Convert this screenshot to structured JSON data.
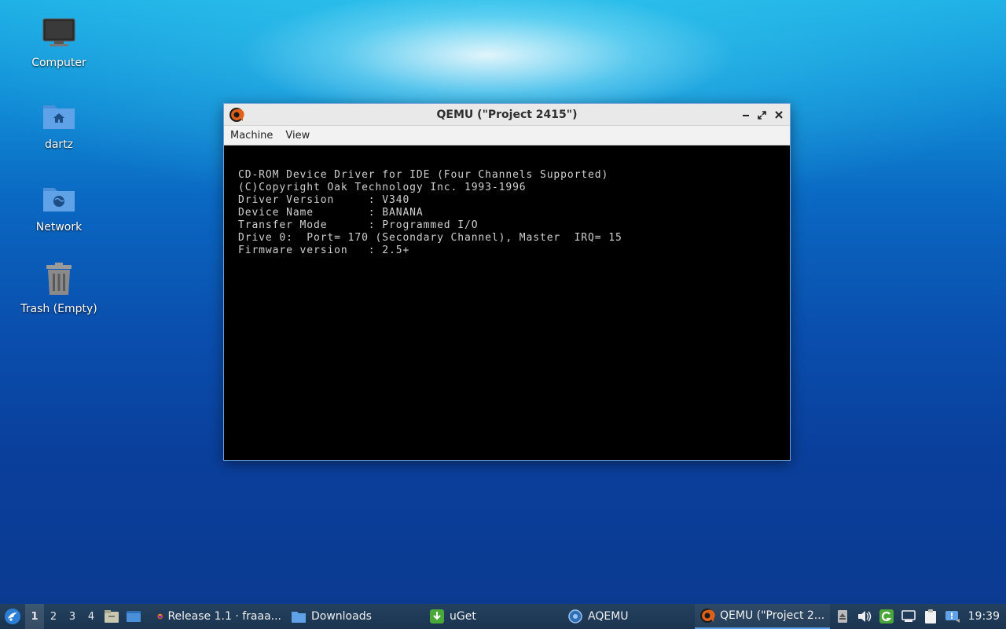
{
  "desktop": {
    "icons": [
      {
        "label": "Computer"
      },
      {
        "label": "dartz"
      },
      {
        "label": "Network"
      },
      {
        "label": "Trash (Empty)"
      }
    ]
  },
  "window": {
    "title": "QEMU (\"Project 2415\")",
    "menu": [
      "Machine",
      "View"
    ],
    "screen_lines": [
      "CD-ROM Device Driver for IDE (Four Channels Supported)",
      "(C)Copyright Oak Technology Inc. 1993-1996",
      "Driver Version     : V340",
      "Device Name        : BANANA",
      "Transfer Mode      : Programmed I/O",
      "Drive 0:  Port= 170 (Secondary Channel), Master  IRQ= 15",
      "Firmware version   : 2.5+"
    ]
  },
  "taskbar": {
    "workspaces": [
      "1",
      "2",
      "3",
      "4"
    ],
    "tasks": [
      {
        "label": "Release 1.1 · fraaa..."
      },
      {
        "label": "Downloads"
      },
      {
        "label": "uGet"
      },
      {
        "label": "AQEMU"
      },
      {
        "label": "QEMU (\"Project 2..."
      }
    ],
    "clock": "19:39"
  },
  "colors": {
    "taskbar": "#1f3a55",
    "window_border": "#6fa1d8",
    "terminal_text": "#cfcfcf",
    "active_task_underline": "#5aa0e6"
  }
}
